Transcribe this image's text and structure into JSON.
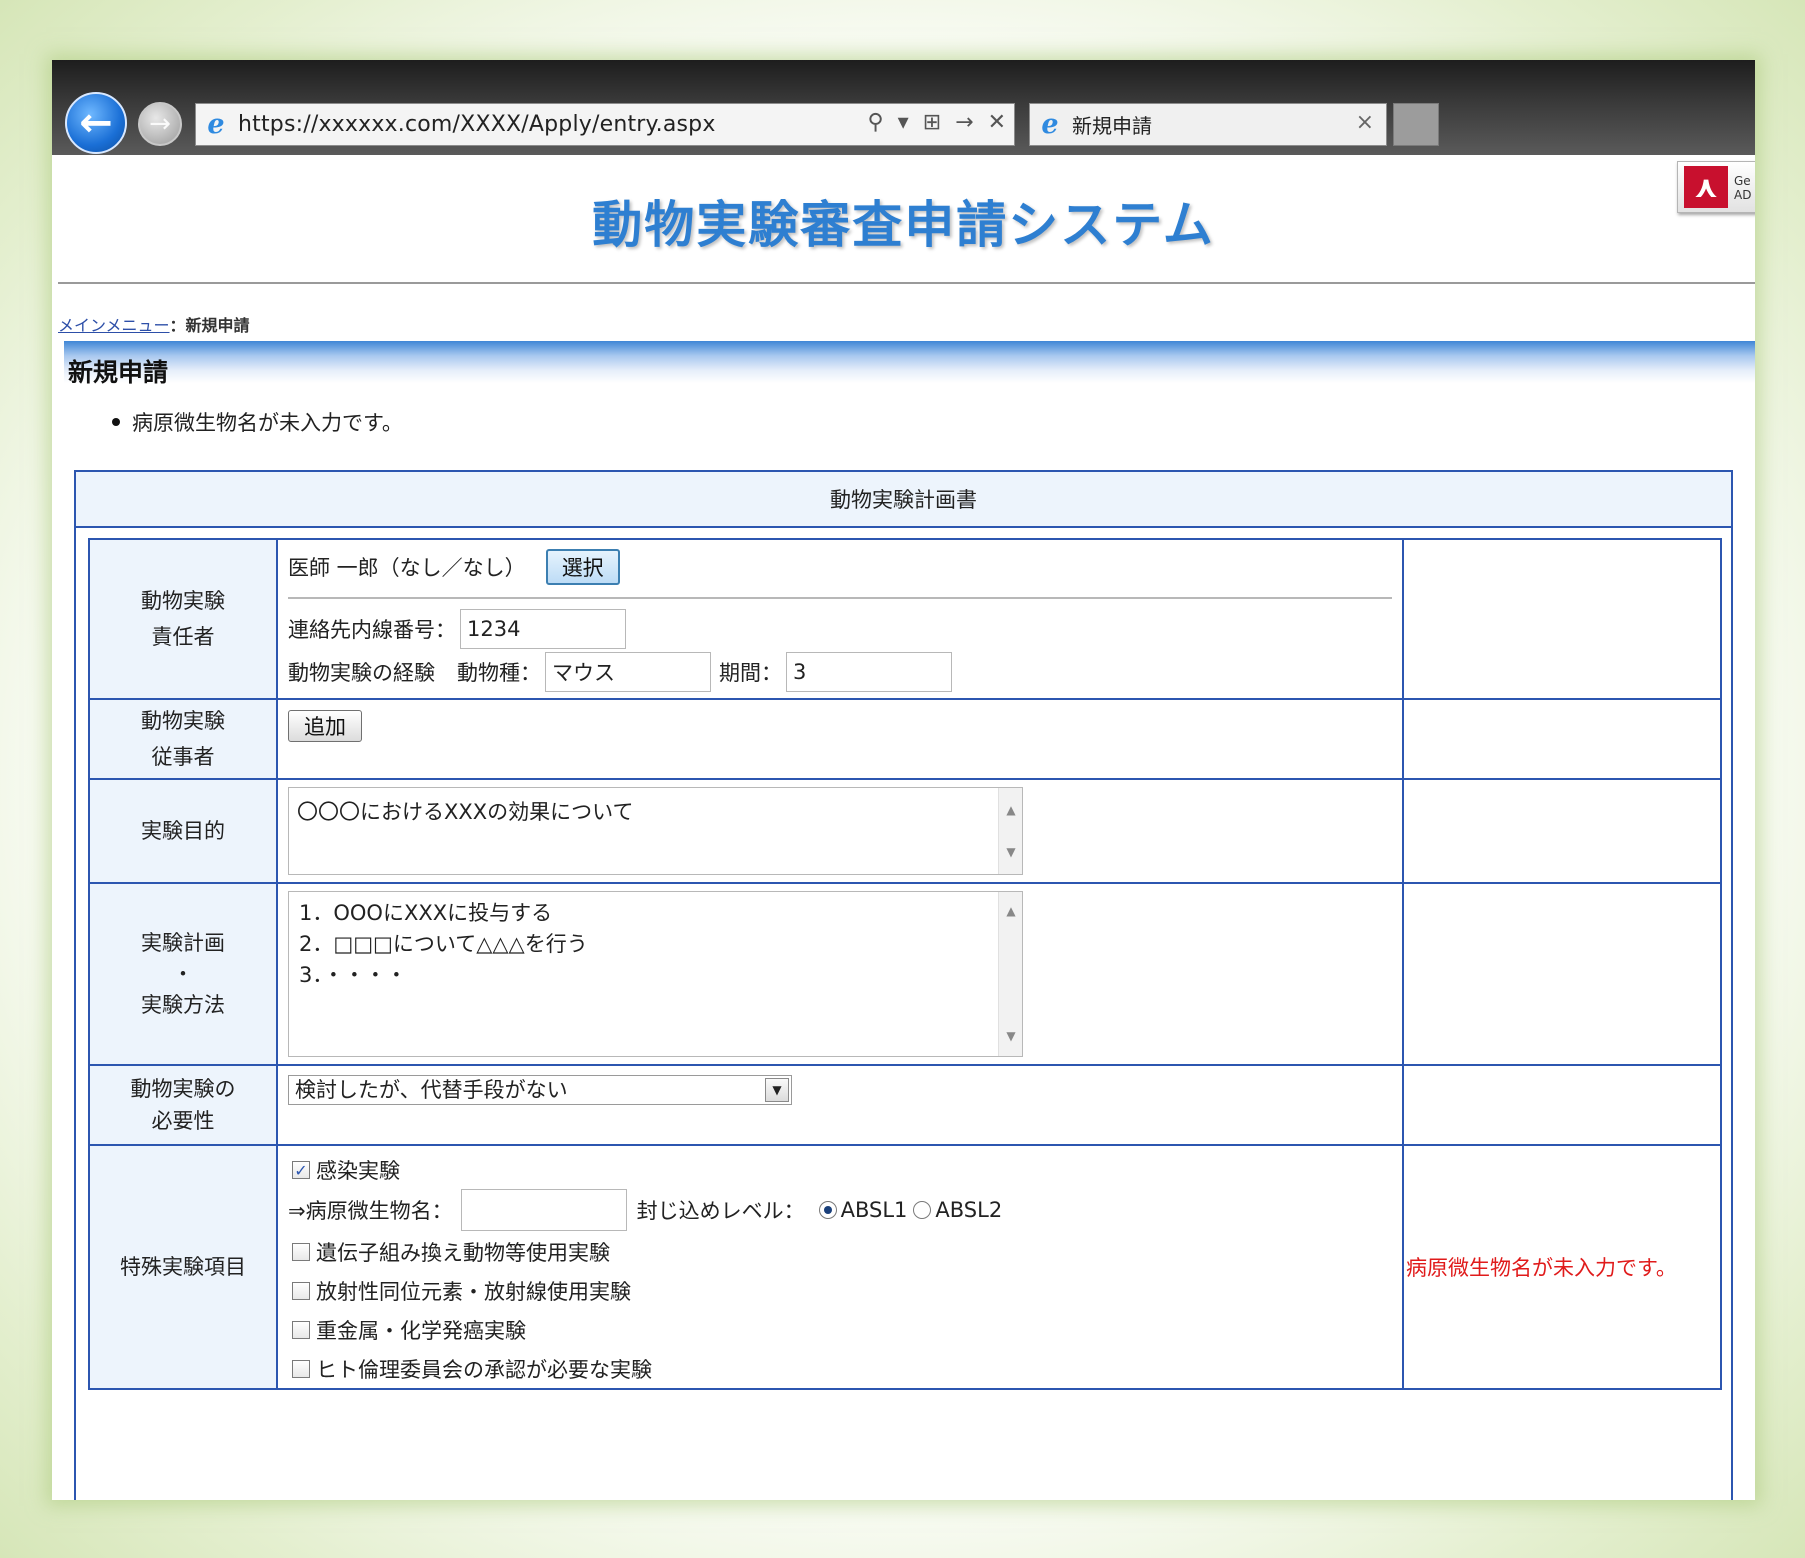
{
  "browser": {
    "url": "https://xxxxxx.com/XXXX/Apply/entry.aspx",
    "tab_title": "新規申請",
    "tab_close": "×",
    "pdf_badge_text": "Ge\nAD"
  },
  "header": {
    "site_title": "動物実験審査申請システム"
  },
  "breadcrumb": {
    "link": "メインメニュー",
    "separator": "：",
    "current": "新規申請"
  },
  "section": {
    "title": "新規申請"
  },
  "errors": {
    "summary": "病原微生物名が未入力です。"
  },
  "form": {
    "title": "動物実験計画書",
    "responsible": {
      "label": "動物実験\n責任者",
      "name": "医師 一郎（なし／なし）",
      "select_button": "選択",
      "extension_label": "連絡先内線番号：",
      "extension_value": "1234",
      "experience_label": "動物実験の経験",
      "species_label": "動物種：",
      "species_value": "マウス",
      "period_label": "期間：",
      "period_value": "3"
    },
    "staff": {
      "label": "動物実験\n従事者",
      "add_button": "追加"
    },
    "purpose": {
      "label": "実験目的",
      "value": "〇〇〇におけるXXXの効果について"
    },
    "plan": {
      "label": "実験計画\n・\n実験方法",
      "line1": "1．OOOにXXXに投与する",
      "line2": "2．□□□について△△△を行う",
      "line3": "3．・・・・"
    },
    "necessity": {
      "label": "動物実験の\n必要性",
      "selected": "検討したが、代替手段がない"
    },
    "special": {
      "label": "特殊実験項目",
      "infection": "感染実験",
      "pathogen_label": "⇒病原微生物名：",
      "pathogen_value": "",
      "containment_label": "封じ込めレベル：",
      "absl1": "ABSL1",
      "absl2": "ABSL2",
      "gmo": "遺伝子組み換え動物等使用実験",
      "radiation": "放射性同位元素・放射線使用実験",
      "heavy_metal": "重金属・化学発癌実験",
      "ethics": "ヒト倫理委員会の承認が必要な実験",
      "error_message": "病原微生物名が未入力です。"
    }
  }
}
